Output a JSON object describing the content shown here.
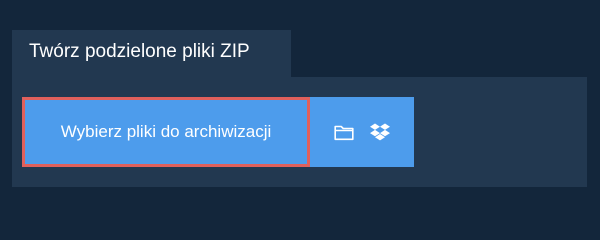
{
  "tab": {
    "label": "Twórz podzielone pliki ZIP"
  },
  "upload": {
    "choose_label": "Wybierz pliki do archiwizacji",
    "folder_icon": "folder-icon",
    "dropbox_icon": "dropbox-icon"
  },
  "colors": {
    "background": "#13263b",
    "panel": "#223850",
    "button": "#4d9cec",
    "highlight_border": "#e0605c"
  }
}
